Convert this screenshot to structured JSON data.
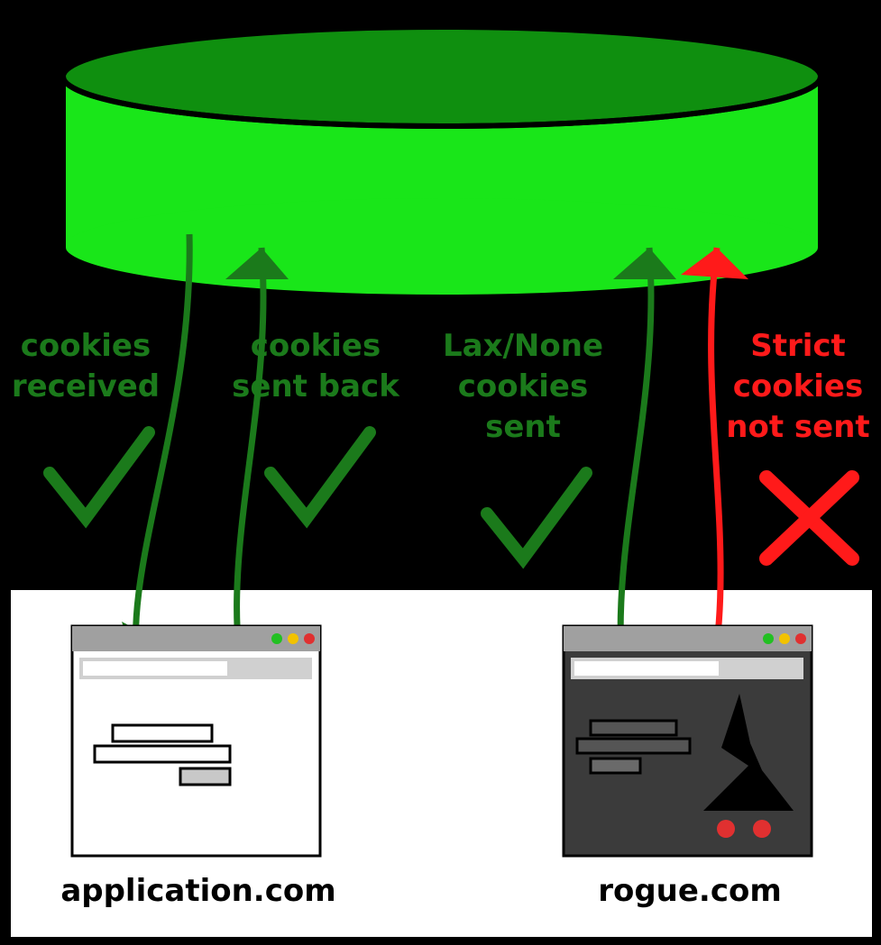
{
  "colors": {
    "green": "#1b7a1b",
    "brightGreen": "#19e619",
    "darkGreenTop": "#0f8f0f",
    "red": "#ff1a1a",
    "grayLight": "#d0d0d0",
    "grayMid": "#a0a0a0",
    "grayDark": "#3b3b3b",
    "black": "#000000"
  },
  "labels": {
    "received1": "cookies",
    "received2": "received",
    "sentBack1": "cookies",
    "sentBack2": "sent back",
    "laxNone1": "Lax/None",
    "laxNone2": "cookies",
    "laxNone3": "sent",
    "strict1": "Strict",
    "strict2": "cookies",
    "strict3": "not sent"
  },
  "sites": {
    "legit": "application.com",
    "rogue": "rogue.com"
  }
}
